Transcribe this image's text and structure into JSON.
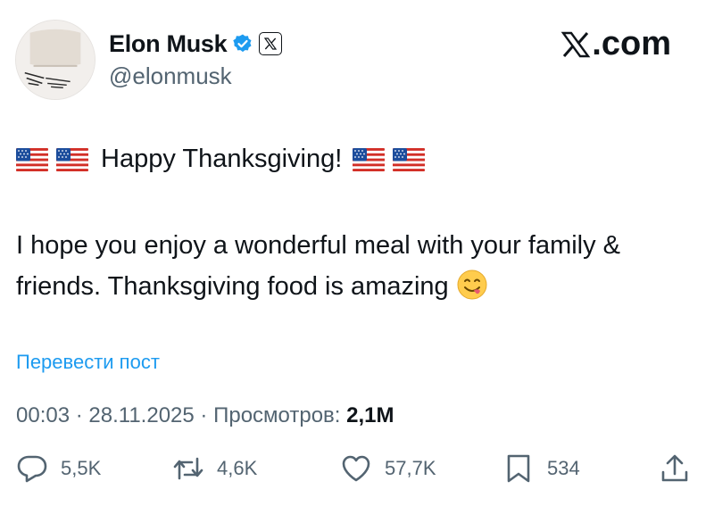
{
  "user": {
    "name": "Elon Musk",
    "handle": "@elonmusk"
  },
  "brand": {
    "x_glyph": "𝕏",
    "domain": ".com"
  },
  "tweet": {
    "greeting": "Happy Thanksgiving!",
    "body": "I hope you enjoy a wonderful meal with your family & friends. Thanksgiving food is amazing"
  },
  "translate_label": "Перевести пост",
  "meta": {
    "time": "00:03",
    "date": "28.11.2025",
    "views_label": "Просмотров:",
    "views_value": "2,1M"
  },
  "actions": {
    "replies": "5,5K",
    "reposts": "4,6K",
    "likes": "57,7K",
    "bookmarks": "534"
  },
  "colors": {
    "link": "#1d9bf0",
    "secondary_text": "#536471",
    "verified": "#1d9bf0"
  }
}
